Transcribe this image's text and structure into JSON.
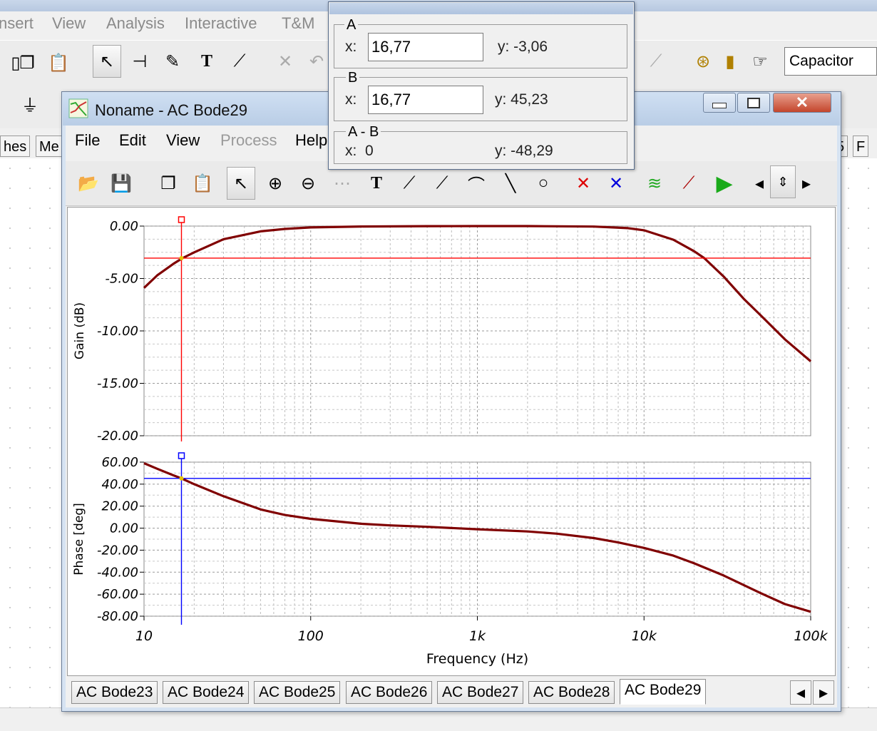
{
  "app": {
    "menu": [
      {
        "label": "nsert",
        "x": -2
      },
      {
        "label": "View",
        "x": 73
      },
      {
        "label": "Analysis",
        "x": 149
      },
      {
        "label": "Interactive",
        "x": 259
      },
      {
        "label": "T&M",
        "x": 395
      }
    ],
    "component_select": "Capacitor",
    "side_tabs": [
      "hes",
      "Me"
    ],
    "right_tabs": [
      "5",
      "F"
    ]
  },
  "window": {
    "title": "Noname - AC Bode29",
    "menu": [
      "File",
      "Edit",
      "View",
      "Process",
      "Help"
    ]
  },
  "cursor": {
    "a": {
      "label": "A",
      "x_label": "x:",
      "x_value": "16,77",
      "y_text": "y: -3,06"
    },
    "b": {
      "label": "B",
      "x_label": "x:",
      "x_value": "16,77",
      "y_text": "y: 45,23"
    },
    "diff": {
      "label": "A - B",
      "x_text": "x:  0",
      "y_text": "y: -48,29"
    }
  },
  "tabs": [
    "AC Bode23",
    "AC Bode24",
    "AC Bode25",
    "AC Bode26",
    "AC Bode27",
    "AC Bode28",
    "AC Bode29"
  ],
  "selected_tab": "AC Bode29",
  "chart_data": [
    {
      "type": "line",
      "ylabel": "Gain (dB)",
      "xscale": "log",
      "xlim": [
        10,
        100000
      ],
      "ylim": [
        -20,
        0
      ],
      "yticks": [
        0,
        -5,
        -10,
        -15,
        -20
      ],
      "ytick_labels": [
        "0.00",
        "-5.00",
        "-10.00",
        "-15.00",
        "-20.00"
      ],
      "grid": true,
      "series": [
        {
          "color": "#800000",
          "x": [
            10,
            12,
            15,
            17,
            20,
            30,
            50,
            70,
            100,
            200,
            500,
            1000,
            2000,
            5000,
            8000,
            10000,
            15000,
            20000,
            23000,
            30000,
            40000,
            50000,
            70000,
            100000
          ],
          "y": [
            -5.9,
            -4.7,
            -3.6,
            -3.06,
            -2.5,
            -1.25,
            -0.5,
            -0.27,
            -0.13,
            -0.04,
            -0.01,
            0,
            0,
            -0.05,
            -0.2,
            -0.4,
            -1.3,
            -2.4,
            -3.06,
            -4.8,
            -7.0,
            -8.5,
            -10.8,
            -12.9
          ]
        }
      ],
      "cursor_a": {
        "x": 16.77,
        "y": -3.06,
        "color": "#ff0000"
      }
    },
    {
      "type": "line",
      "xlabel": "Frequency (Hz)",
      "ylabel": "Phase [deg]",
      "xscale": "log",
      "xlim": [
        10,
        100000
      ],
      "ylim": [
        -80,
        60
      ],
      "yticks": [
        60,
        40,
        20,
        0,
        -20,
        -40,
        -60,
        -80
      ],
      "ytick_labels": [
        "60.00",
        "40.00",
        "20.00",
        "0.00",
        "-20.00",
        "-40.00",
        "-60.00",
        "-80.00"
      ],
      "xticks": [
        10,
        100,
        1000,
        10000,
        100000
      ],
      "xtick_labels": [
        "10",
        "100",
        "1k",
        "10k",
        "100k"
      ],
      "grid": true,
      "series": [
        {
          "color": "#800000",
          "x": [
            10,
            12,
            15,
            16.77,
            20,
            30,
            50,
            70,
            100,
            200,
            300,
            500,
            1000,
            2000,
            3000,
            5000,
            7000,
            10000,
            15000,
            20000,
            30000,
            50000,
            70000,
            100000
          ],
          "y": [
            59,
            54,
            48,
            45.23,
            40,
            29,
            17,
            12,
            8.5,
            4,
            2.5,
            1.2,
            -1,
            -3,
            -5,
            -9,
            -13,
            -18,
            -25,
            -32,
            -43,
            -59,
            -69,
            -76
          ]
        }
      ],
      "cursor_b": {
        "x": 16.77,
        "y": 45.23,
        "color": "#0000ff"
      }
    }
  ]
}
